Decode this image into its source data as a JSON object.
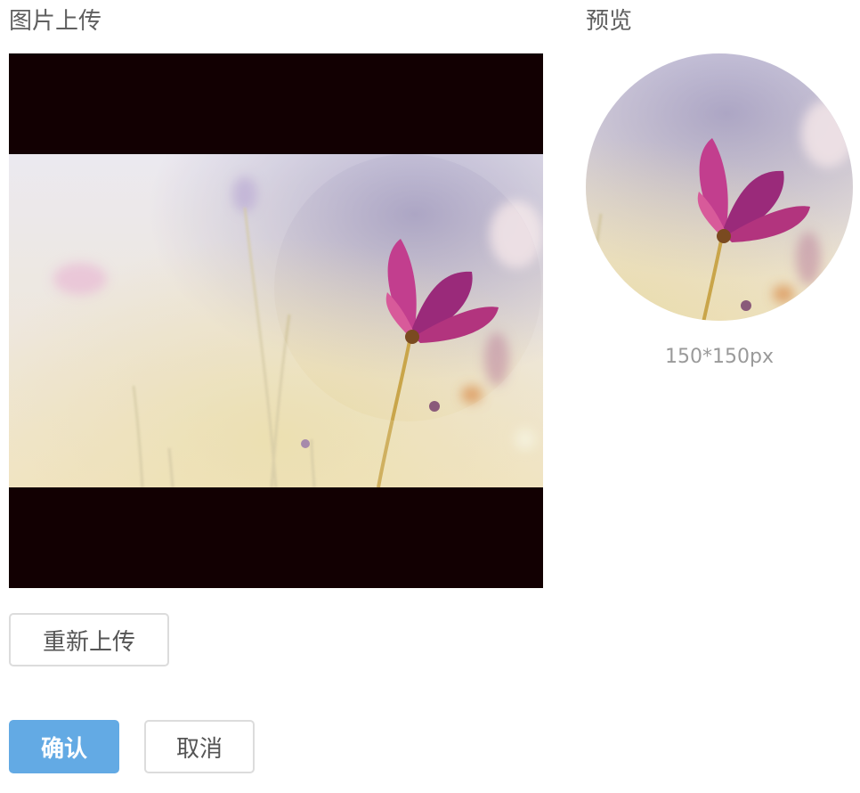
{
  "upload_panel": {
    "title": "图片上传",
    "reupload_label": "重新上传"
  },
  "preview_panel": {
    "title": "预览",
    "size_label": "150*150px"
  },
  "actions": {
    "confirm_label": "确认",
    "cancel_label": "取消"
  },
  "colors": {
    "primary": "#63aae4",
    "stage_background": "#120002",
    "border": "#dcdcdc"
  }
}
